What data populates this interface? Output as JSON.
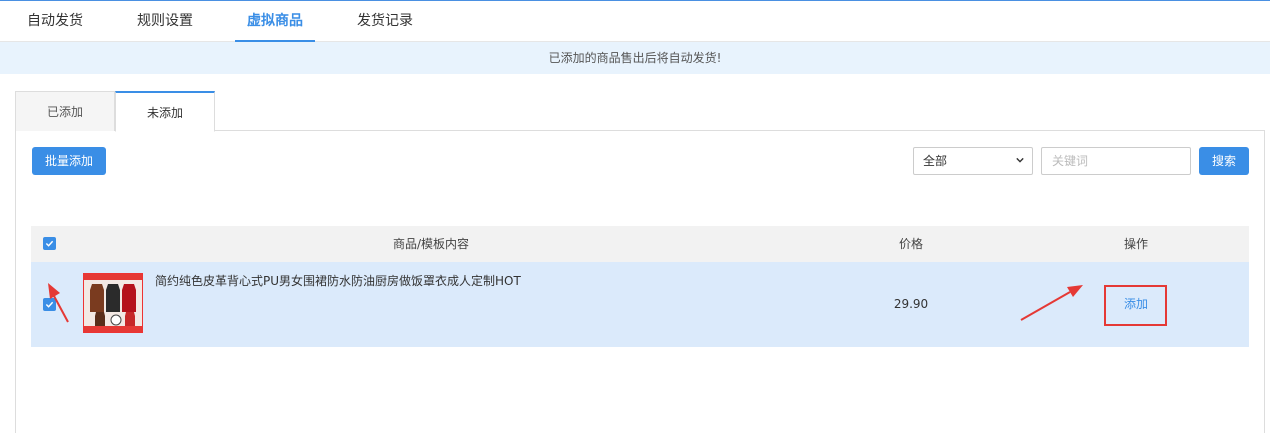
{
  "top_tabs": [
    {
      "label": "自动发货",
      "active": false
    },
    {
      "label": "规则设置",
      "active": false
    },
    {
      "label": "虚拟商品",
      "active": true
    },
    {
      "label": "发货记录",
      "active": false
    }
  ],
  "notice": "已添加的商品售出后将自动发货!",
  "sub_tabs": [
    {
      "label": "已添加",
      "active": false
    },
    {
      "label": "未添加",
      "active": true
    }
  ],
  "toolbar": {
    "batch_add_label": "批量添加",
    "filter_selected": "全部",
    "keyword_placeholder": "关键词",
    "search_label": "搜索"
  },
  "table": {
    "headers": {
      "product": "商品/模板内容",
      "price": "价格",
      "action": "操作"
    },
    "rows": [
      {
        "checked": true,
        "title": "简约纯色皮革背心式PU男女围裙防水防油厨房做饭罩衣成人定制HOT",
        "price": "29.90",
        "action": "添加"
      }
    ]
  },
  "colors": {
    "accent": "#3a8ee6",
    "notice_bg": "#e8f3fd",
    "selected_row_bg": "#dbeafb",
    "annotation": "#e53935"
  }
}
